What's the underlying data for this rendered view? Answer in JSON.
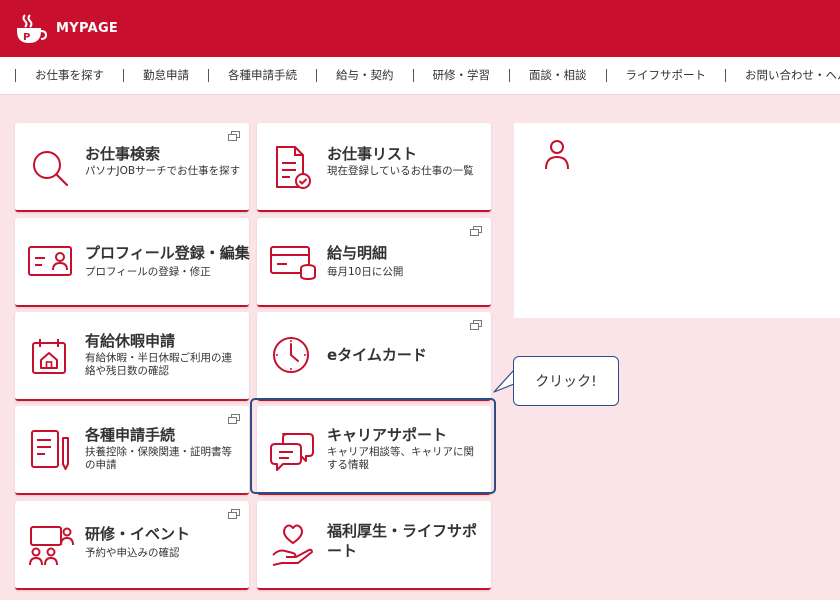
{
  "header": {
    "title": "MYPAGE"
  },
  "nav": [
    {
      "label": "お仕事を探す"
    },
    {
      "label": "勤怠申請"
    },
    {
      "label": "各種申請手続"
    },
    {
      "label": "給与・契約"
    },
    {
      "label": "研修・学習"
    },
    {
      "label": "面談・相談"
    },
    {
      "label": "ライフサポート"
    },
    {
      "label": "お問い合わせ・ヘルプ"
    }
  ],
  "tiles": [
    {
      "title": "お仕事検索",
      "desc": "パソナJOBサーチでお仕事を探す",
      "icon": "search-icon"
    },
    {
      "title": "お仕事リスト",
      "desc": "現在登録しているお仕事の一覧",
      "icon": "document-check-icon"
    },
    {
      "title": "プロフィール登録・編集",
      "desc": "プロフィールの登録・修正",
      "icon": "id-card-icon"
    },
    {
      "title": "給与明細",
      "desc": "毎月10日に公開",
      "icon": "card-coins-icon"
    },
    {
      "title": "有給休暇申請",
      "desc": "有給休暇・半日休暇ご利用の連絡や残日数の確認",
      "icon": "calendar-house-icon"
    },
    {
      "title": "eタイムカード",
      "desc": "",
      "icon": "clock-icon"
    },
    {
      "title": "各種申請手続",
      "desc": "扶養控除・保険関連・証明書等の申請",
      "icon": "form-pen-icon"
    },
    {
      "title": "キャリアサポート",
      "desc": "キャリア相談等、キャリアに関する情報",
      "icon": "chat-bubbles-icon"
    },
    {
      "title": "研修・イベント",
      "desc": "予約や申込みの確認",
      "icon": "seminar-icon"
    },
    {
      "title": "福利厚生・ライフサポート",
      "desc": "",
      "icon": "heart-hand-icon"
    }
  ],
  "callout": {
    "text": "クリック!"
  },
  "colors": {
    "brand": "#c8102e",
    "background": "#fbe4e7",
    "highlight": "#2e4d86"
  }
}
